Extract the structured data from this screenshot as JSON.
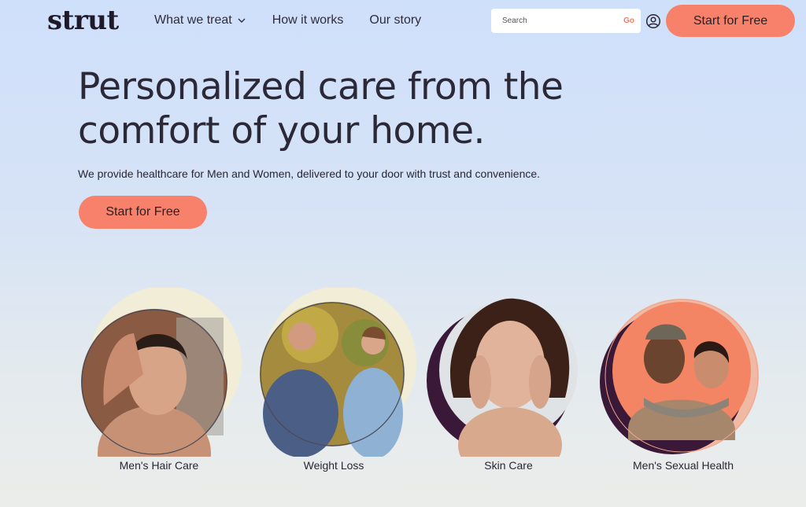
{
  "header": {
    "logo": "strut",
    "nav": [
      {
        "label": "What we treat",
        "has_dropdown": true
      },
      {
        "label": "How it works"
      },
      {
        "label": "Our story"
      }
    ],
    "search": {
      "placeholder": "Search",
      "button": "Go"
    },
    "account_icon": "user-circle-icon",
    "cta": "Start for Free"
  },
  "hero": {
    "title_line1": "Personalized care from the",
    "title_line2": "comfort of your home.",
    "subtitle": "We provide healthcare for Men and Women, delivered to your door with trust and convenience.",
    "cta": "Start for Free"
  },
  "categories": [
    {
      "label": "Men's Hair Care"
    },
    {
      "label": "Weight Loss"
    },
    {
      "label": "Skin Care"
    },
    {
      "label": "Men's Sexual Health"
    }
  ],
  "colors": {
    "accent": "#f7816a",
    "text": "#2b2838",
    "deep_plum": "#3a1838",
    "cream": "#f1edd6"
  }
}
